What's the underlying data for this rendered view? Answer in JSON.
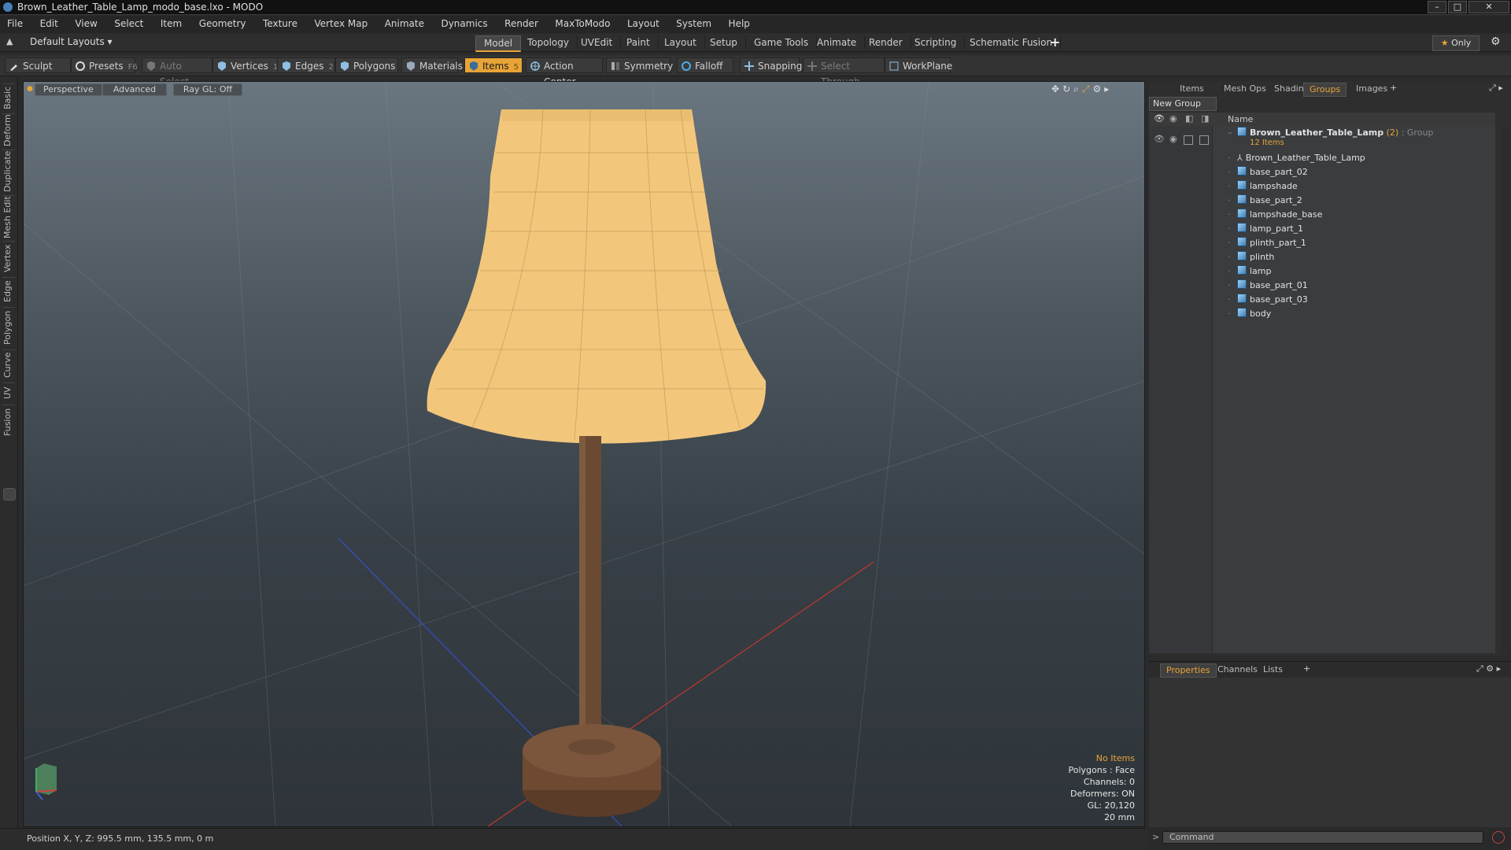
{
  "window": {
    "title": "Brown_Leather_Table_Lamp_modo_base.lxo - MODO"
  },
  "menu": [
    "File",
    "Edit",
    "View",
    "Select",
    "Item",
    "Geometry",
    "Texture",
    "Vertex Map",
    "Animate",
    "Dynamics",
    "Render",
    "MaxToModo",
    "Layout",
    "System",
    "Help"
  ],
  "layoutbar": {
    "layouts_label": "Default Layouts",
    "tabs": [
      "Model",
      "Topology",
      "UVEdit",
      "Paint",
      "Layout",
      "Setup",
      "Game Tools",
      "Animate",
      "Render",
      "Scripting",
      "Schematic Fusion"
    ],
    "active_tab": "Model",
    "add": "+",
    "only_label": "Only"
  },
  "toolbar": {
    "sculpt": "Sculpt",
    "presets": "Presets",
    "presets_key": "F6",
    "auto_select": "Auto Select",
    "vertices": "Vertices",
    "vertices_count": "1",
    "edges": "Edges",
    "edges_count": "2",
    "polygons": "Polygons",
    "materials": "Materials",
    "items": "Items",
    "items_count": "5",
    "action_center": "Action Center",
    "symmetry": "Symmetry",
    "falloff": "Falloff",
    "snapping": "Snapping",
    "select_through": "Select Through",
    "workplane": "WorkPlane"
  },
  "left_tabs": [
    "Basic",
    "Deform",
    "Duplicate",
    "Mesh Edit",
    "Vertex",
    "Edge",
    "Polygon",
    "Curve",
    "UV",
    "Fusion"
  ],
  "viewport": {
    "view_label": "Perspective",
    "advanced_label": "Advanced",
    "raygl_label": "Ray GL: Off",
    "stats": {
      "no_items": "No Items",
      "polygons": "Polygons : Face",
      "channels": "Channels: 0",
      "deformers": "Deformers: ON",
      "gl": "GL: 20,120",
      "scale": "20 mm"
    },
    "colors": {
      "lampshade": "#f2c77c",
      "wood": "#6b4a33",
      "axis_x": "#c0392b",
      "axis_z": "#3850c8"
    }
  },
  "right_panel": {
    "tabs": [
      "Items",
      "Mesh Ops",
      "Shading",
      "Groups",
      "Images"
    ],
    "active_tab": "Groups",
    "new_group": "New Group",
    "name_header": "Name",
    "group": {
      "name": "Brown_Leather_Table_Lamp",
      "count": "(2)",
      "type": ": Group",
      "subtitle": "12 Items"
    },
    "items": [
      "Brown_Leather_Table_Lamp",
      "base_part_02",
      "lampshade",
      "base_part_2",
      "lampshade_base",
      "lamp_part_1",
      "plinth_part_1",
      "plinth",
      "lamp",
      "base_part_01",
      "base_part_03",
      "body"
    ]
  },
  "bottom_panel": {
    "tabs": [
      "Properties",
      "Channels",
      "Lists"
    ],
    "active_tab": "Properties"
  },
  "command": {
    "placeholder": "Command"
  },
  "status": {
    "position": "Position X, Y, Z:  995.5 mm, 135.5 mm, 0 m"
  }
}
